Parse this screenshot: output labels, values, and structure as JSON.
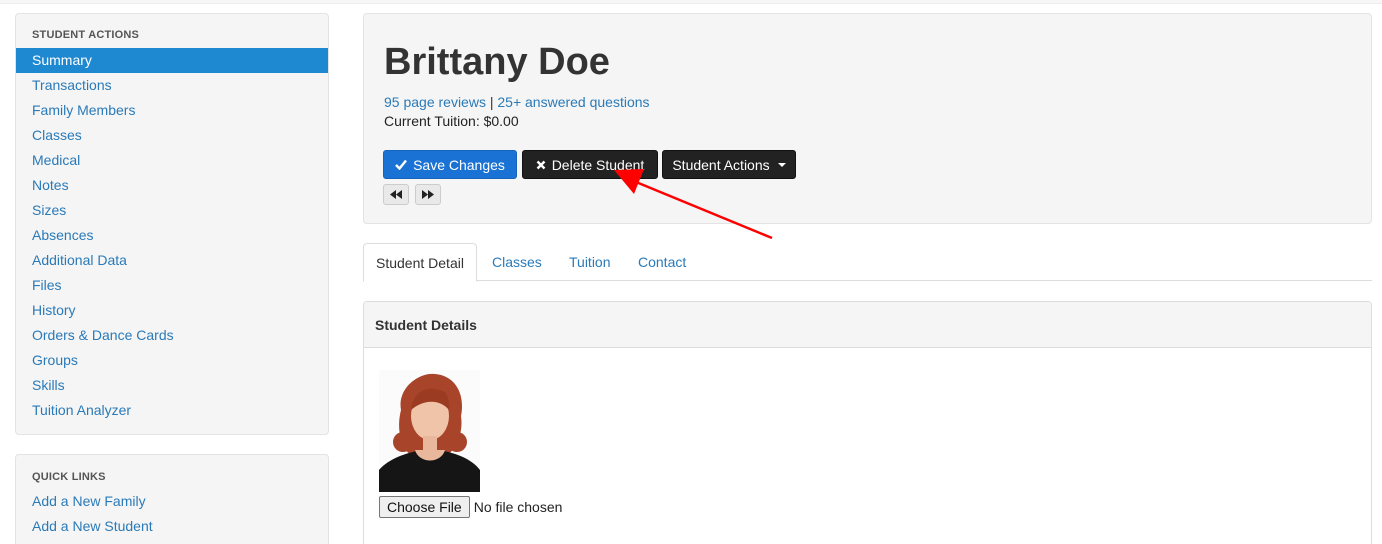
{
  "sidebar": {
    "heading": "STUDENT ACTIONS",
    "items": [
      {
        "label": "Summary",
        "active": true
      },
      {
        "label": "Transactions"
      },
      {
        "label": "Family Members"
      },
      {
        "label": "Classes"
      },
      {
        "label": "Medical"
      },
      {
        "label": "Notes"
      },
      {
        "label": "Sizes"
      },
      {
        "label": "Absences"
      },
      {
        "label": "Additional Data"
      },
      {
        "label": "Files"
      },
      {
        "label": "History"
      },
      {
        "label": "Orders & Dance Cards"
      },
      {
        "label": "Groups"
      },
      {
        "label": "Skills"
      },
      {
        "label": "Tuition Analyzer"
      }
    ]
  },
  "quick_links": {
    "heading": "QUICK LINKS",
    "items": [
      {
        "label": "Add a New Family"
      },
      {
        "label": "Add a New Student"
      }
    ]
  },
  "header": {
    "student_name": "Brittany Doe",
    "reviews_link": "95 page reviews",
    "separator": "|",
    "questions_link": "25+ answered questions",
    "tuition_label": "Current Tuition: $0.00",
    "save_label": "Save Changes",
    "delete_label": "Delete Student",
    "actions_label": "Student Actions"
  },
  "tabs": [
    {
      "label": "Student Detail",
      "active": true
    },
    {
      "label": "Classes"
    },
    {
      "label": "Tuition"
    },
    {
      "label": "Contact"
    }
  ],
  "details": {
    "title": "Student Details",
    "choose_file_label": "Choose File",
    "file_status": "No file chosen"
  },
  "colors": {
    "primary": "#1a73d4",
    "link": "#2a7ab8",
    "active_nav": "#1e88d0",
    "dark_button": "#222222",
    "annotation_arrow": "#ff0000"
  },
  "icons": {
    "save": "checkmark-icon",
    "delete": "x-icon",
    "actions": "caret-down-icon",
    "prev": "rewind-icon",
    "next": "fast-forward-icon"
  }
}
